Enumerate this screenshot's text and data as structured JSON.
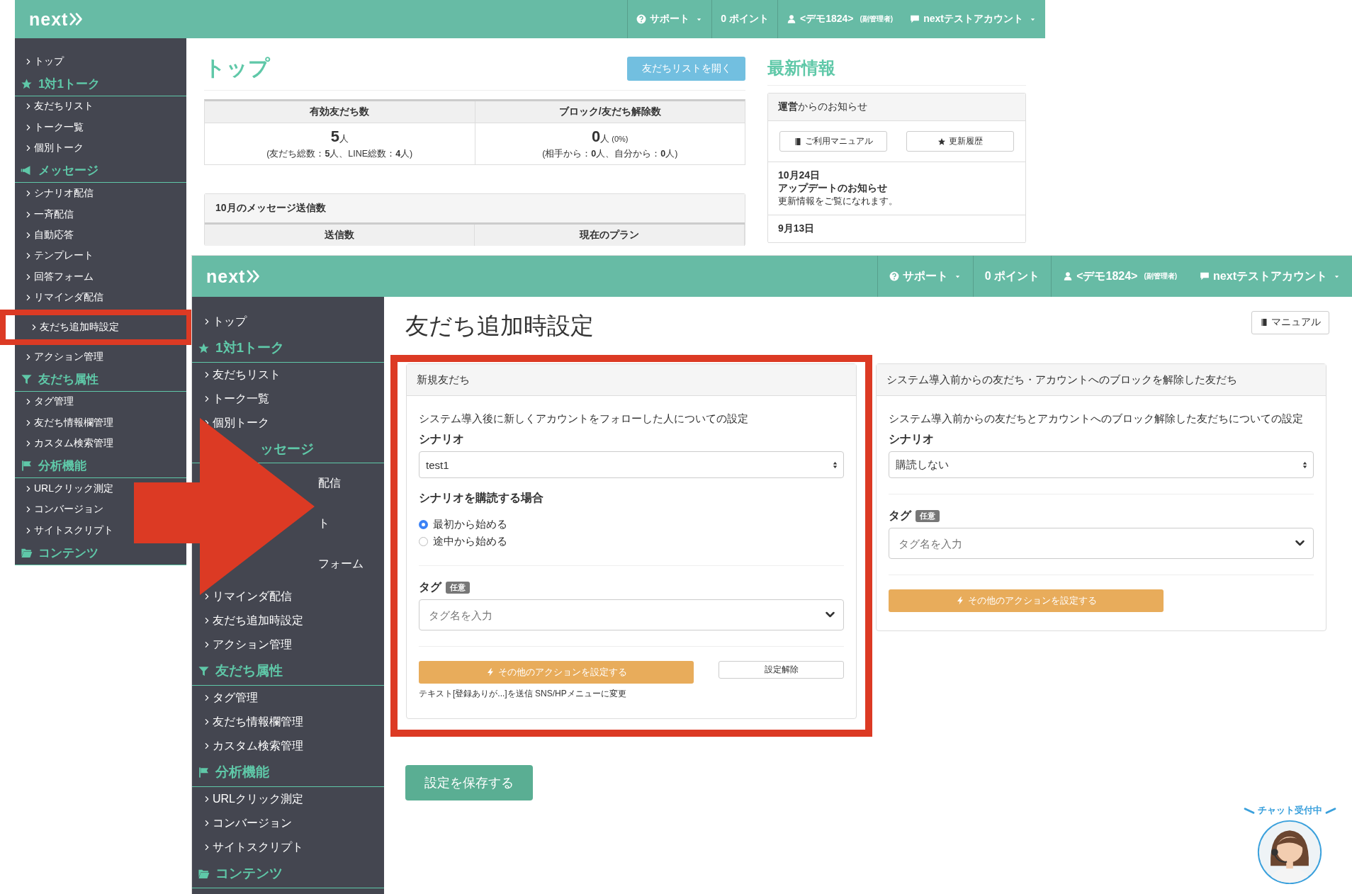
{
  "back_window": {
    "header": {
      "logo": "next",
      "nav": [
        {
          "kind": "help",
          "label": "サポート",
          "dropdown": true
        },
        {
          "kind": "plain",
          "label": "0 ポイント",
          "dropdown": false
        },
        {
          "kind": "user",
          "label": "<デモ1824>",
          "note": "(副管理者)",
          "dropdown": false
        },
        {
          "kind": "chat",
          "label": "nextテストアカウント",
          "dropdown": true
        }
      ]
    },
    "sidebar": [
      {
        "kind": "link",
        "label": "トップ",
        "highlighted": false
      },
      {
        "kind": "heading",
        "label": "1対1トーク",
        "highlighted": false
      },
      {
        "kind": "link",
        "label": "友だちリスト",
        "highlighted": false
      },
      {
        "kind": "link",
        "label": "トーク一覧",
        "highlighted": false
      },
      {
        "kind": "link",
        "label": "個別トーク",
        "highlighted": false
      },
      {
        "kind": "heading",
        "label": "メッセージ",
        "highlighted": false
      },
      {
        "kind": "link",
        "label": "シナリオ配信",
        "highlighted": false
      },
      {
        "kind": "link",
        "label": "一斉配信",
        "highlighted": false
      },
      {
        "kind": "link",
        "label": "自動応答",
        "highlighted": false
      },
      {
        "kind": "link",
        "label": "テンプレート",
        "highlighted": false
      },
      {
        "kind": "link",
        "label": "回答フォーム",
        "highlighted": false
      },
      {
        "kind": "link",
        "label": "リマインダ配信",
        "highlighted": false
      },
      {
        "kind": "link",
        "label": "友だち追加時設定",
        "highlighted": true
      },
      {
        "kind": "link",
        "label": "アクション管理",
        "highlighted": false
      },
      {
        "kind": "heading",
        "label": "友だち属性",
        "highlighted": false
      },
      {
        "kind": "link",
        "label": "タグ管理",
        "highlighted": false
      },
      {
        "kind": "link",
        "label": "友だち情報欄管理",
        "highlighted": false
      },
      {
        "kind": "link",
        "label": "カスタム検索管理",
        "highlighted": false
      },
      {
        "kind": "heading",
        "label": "分析機能",
        "highlighted": false
      },
      {
        "kind": "link",
        "label": "URLクリック測定",
        "highlighted": false
      },
      {
        "kind": "link",
        "label": "コンバージョン",
        "highlighted": false
      },
      {
        "kind": "link",
        "label": "サイトスクリプト",
        "highlighted": false
      },
      {
        "kind": "heading",
        "label": "コンテンツ",
        "highlighted": false
      }
    ],
    "page": {
      "title": "トップ",
      "open_list_button": "友だちリストを開く",
      "stats": [
        {
          "heading": "有効友だち数",
          "value": "5",
          "unit": "人",
          "detail": "(友だち総数：**5**人、LINE総数：**4**人)"
        },
        {
          "heading": "ブロック/友だち解除数",
          "value": "0",
          "unit": "人",
          "extra": "(0%)",
          "detail": "(相手から：**0**人、自分から：**0**人)"
        }
      ],
      "messages_panel": {
        "title": "10月のメッセージ送信数",
        "columns": [
          "送信数",
          "現在のプラン"
        ]
      },
      "news": {
        "title": "最新情報",
        "panel_title": "**運営**からのお知らせ",
        "buttons": [
          "ご利用マニュアル",
          "更新履歴"
        ],
        "items": [
          {
            "date": "10月24日",
            "title": "アップデートのお知らせ",
            "body": "更新情報をご覧になれます。"
          },
          {
            "date": "9月13日"
          }
        ]
      }
    }
  },
  "front_window": {
    "header": {
      "logo": "next",
      "nav": [
        {
          "kind": "help",
          "label": "サポート",
          "dropdown": true
        },
        {
          "kind": "plain",
          "label": "0 ポイント",
          "dropdown": false
        },
        {
          "kind": "user",
          "label": "<デモ1824>",
          "note": "(副管理者)",
          "dropdown": false
        },
        {
          "kind": "chat",
          "label": "nextテストアカウント",
          "dropdown": true
        }
      ]
    },
    "sidebar": [
      {
        "kind": "link",
        "label": "トップ",
        "covered": false
      },
      {
        "kind": "heading",
        "label": "1対1トーク",
        "covered": false
      },
      {
        "kind": "link",
        "label": "友だちリスト",
        "covered": false
      },
      {
        "kind": "link",
        "label": "トーク一覧",
        "covered": false
      },
      {
        "kind": "link",
        "label": "個別トーク",
        "covered": false
      },
      {
        "kind": "heading",
        "label": "ッセージ",
        "covered": true
      },
      {
        "kind": "link",
        "label": "配信",
        "covered": true
      },
      {
        "kind": "link",
        "label": "ト",
        "covered": true
      },
      {
        "kind": "link",
        "label": "フォーム",
        "covered": true
      },
      {
        "kind": "link",
        "label": "リマインダ配信",
        "covered": false
      },
      {
        "kind": "link",
        "label": "友だち追加時設定",
        "covered": false
      },
      {
        "kind": "link",
        "label": "アクション管理",
        "covered": false
      },
      {
        "kind": "heading",
        "label": "友だち属性",
        "covered": false
      },
      {
        "kind": "link",
        "label": "タグ管理",
        "covered": false
      },
      {
        "kind": "link",
        "label": "友だち情報欄管理",
        "covered": false
      },
      {
        "kind": "link",
        "label": "カスタム検索管理",
        "covered": false
      },
      {
        "kind": "heading",
        "label": "分析機能",
        "covered": false
      },
      {
        "kind": "link",
        "label": "URLクリック測定",
        "covered": false
      },
      {
        "kind": "link",
        "label": "コンバージョン",
        "covered": false
      },
      {
        "kind": "link",
        "label": "サイトスクリプト",
        "covered": false
      },
      {
        "kind": "heading",
        "label": "コンテンツ",
        "covered": false
      }
    ],
    "page": {
      "title": "友だち追加時設定",
      "manual_button": "マニュアル",
      "panels": [
        {
          "highlighted": true,
          "header": "新規友だち",
          "description": "システム導入後に新しくアカウントをフォローした人についての設定",
          "scenario_label": "シナリオ",
          "scenario_value": "test1",
          "subscribe": {
            "label": "シナリオを購読する場合",
            "options": [
              {
                "label": "最初から始める",
                "selected": true
              },
              {
                "label": "途中から始める",
                "selected": false
              }
            ]
          },
          "tag_label": "タグ",
          "optional_badge": "任意",
          "tag_placeholder": "タグ名を入力",
          "action_button": "その他のアクションを設定する",
          "clear_button": "設定解除",
          "action_summary": "テキスト[登録ありが...]を送信 SNS/HPメニューに変更"
        },
        {
          "highlighted": false,
          "header": "システム導入前からの友だち・アカウントへのブロックを解除した友だち",
          "description": "システム導入前からの友だちとアカウントへのブロック解除した友だちについての設定",
          "scenario_label": "シナリオ",
          "scenario_value": "購読しない",
          "tag_label": "タグ",
          "optional_badge": "任意",
          "tag_placeholder": "タグ名を入力",
          "action_button": "その他のアクションを設定する"
        }
      ],
      "save_button": "設定を保存する"
    },
    "chat_widget": {
      "label": "チャット受付中",
      "kind": "picture"
    }
  }
}
